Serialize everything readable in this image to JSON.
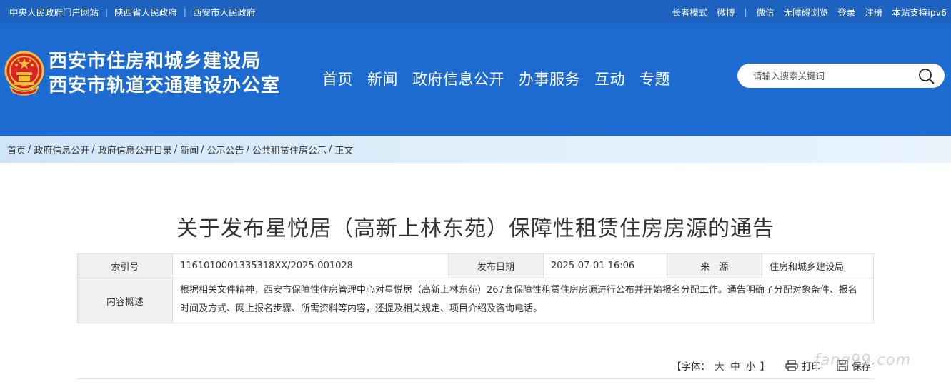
{
  "topbar": {
    "left_links": [
      "中央人民政府门户网站",
      "陕西省人民政府",
      "西安市人民政府"
    ],
    "right_links": [
      "长者模式",
      "微博",
      "微信",
      "无障碍浏览",
      "登录",
      "注册",
      "本站支持ipv6"
    ]
  },
  "header": {
    "title_line1": "西安市住房和城乡建设局",
    "title_line2": "西安市轨道交通建设办公室",
    "nav": [
      "首页",
      "新闻",
      "政府信息公开",
      "办事服务",
      "互动",
      "专题"
    ],
    "search_placeholder": "请输入搜索关键词"
  },
  "breadcrumb": [
    "首页",
    "政府信息公开",
    "政府信息公开目录",
    "新闻",
    "公示公告",
    "公共租赁住房公示",
    "正文"
  ],
  "article": {
    "title": "关于发布星悦居（高新上林东苑）保障性租赁住房房源的通告",
    "meta": {
      "index_label": "索引号",
      "index_value": "1161010001335318XX/2025-001028",
      "date_label": "发布日期",
      "date_value": "2025-07-01 16:06",
      "source_label": "来　源",
      "source_value": "住房和城乡建设局",
      "summary_label": "内容概述",
      "summary_value": "根据相关文件精神，西安市保障性住房管理中心对星悦居（高新上林东苑）267套保障性租赁住房房源进行公布并开始报名分配工作。通告明确了分配对象条件、报名时间及方式、网上报名步骤、所需资料等内容，还提及相关规定、项目介绍及咨询电话。"
    }
  },
  "tools": {
    "font_prefix": "【字体：",
    "font_large": "大",
    "font_medium": "中",
    "font_small": "小",
    "font_suffix": "】",
    "print_label": "打印",
    "save_label": "保存"
  },
  "watermark": "fang99.com",
  "colors": {
    "topbar_bg": "#1f63c0",
    "header_bg": "#1d6bd0",
    "breadcrumb_bg": "#d6eaf9",
    "label_cell_bg": "#f1f1f1"
  }
}
